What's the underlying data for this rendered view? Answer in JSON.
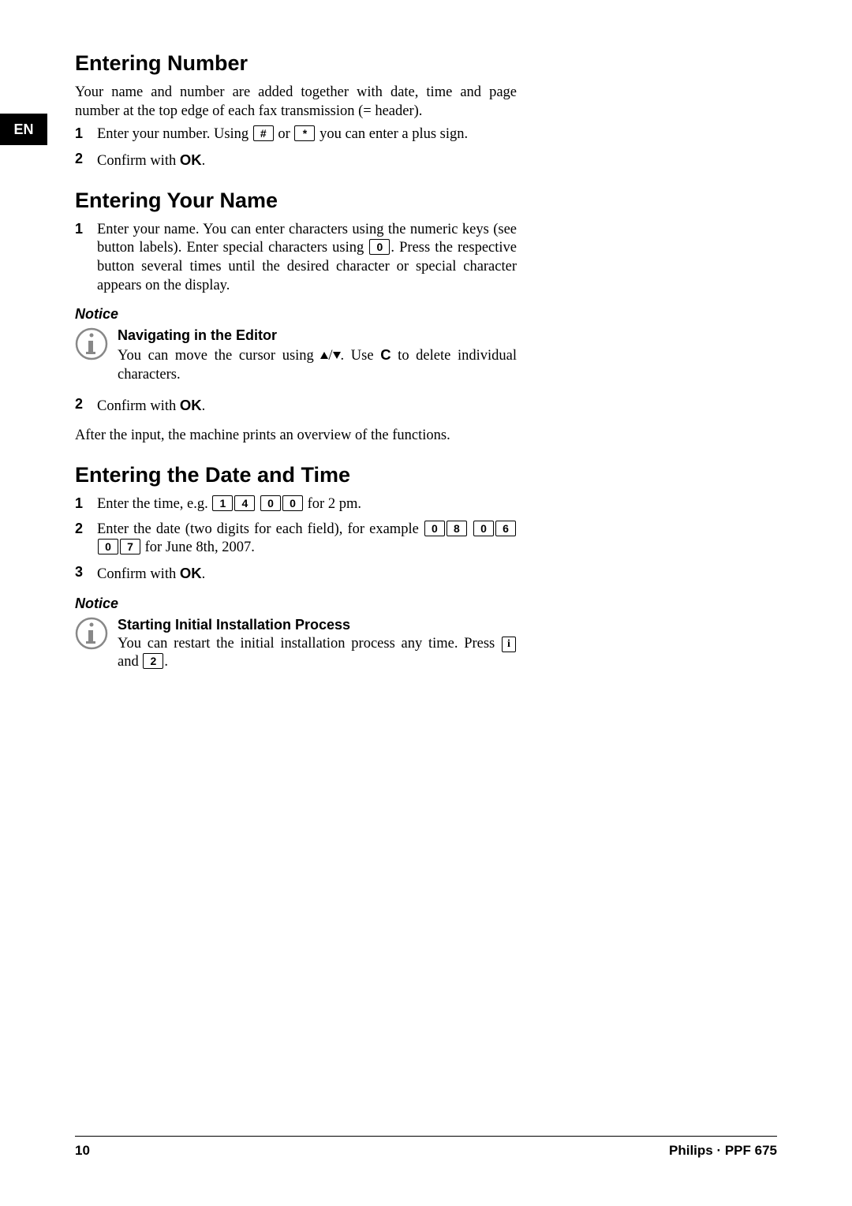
{
  "lang_tab": "EN",
  "section1": {
    "heading": "Entering Number",
    "intro": "Your name and number are added together with date, time and page number at the top edge of each fax transmission (= header).",
    "step1a": "Enter your number. Using ",
    "key_hash": "#",
    "step1b": " or ",
    "key_star": "*",
    "step1c": " you can enter a plus sign.",
    "step2a": "Confirm with ",
    "step2b": "OK",
    "step2c": "."
  },
  "section2": {
    "heading": "Entering Your Name",
    "step1a": "Enter your name. You can enter characters using the numeric keys (see button labels).  Enter special characters using ",
    "key_0": "0",
    "step1b": ". Press the respective button several times until the desired character or special character appears on the display.",
    "notice_label": "Notice",
    "notice_title": "Navigating in the Editor",
    "notice_text_a": "You can move the cursor using ",
    "notice_text_b": ". Use ",
    "notice_text_c": "C",
    "notice_text_d": " to delete individual characters.",
    "step2a": "Confirm with ",
    "step2b": "OK",
    "step2c": ".",
    "outro": "After the input, the machine prints an overview of the functions."
  },
  "section3": {
    "heading": "Entering the Date and Time",
    "step1a": "Enter the time, e.g. ",
    "keys_time": [
      "1",
      "4",
      "0",
      "0"
    ],
    "step1b": " for 2 pm.",
    "step2a": "Enter the date (two digits for each field), for example ",
    "keys_date": [
      "0",
      "8",
      "0",
      "6",
      "0",
      "7"
    ],
    "step2b": " for June 8th, 2007.",
    "step3a": "Confirm with ",
    "step3b": "OK",
    "step3c": ".",
    "notice_label": "Notice",
    "notice_title": "Starting Initial Installation Process",
    "notice_text_a": "You can restart the initial installation process any time. Press ",
    "key_i": "i",
    "notice_text_b": " and ",
    "key_2": "2",
    "notice_text_c": "."
  },
  "footer": {
    "page": "10",
    "brand": "Philips · PPF 675"
  }
}
